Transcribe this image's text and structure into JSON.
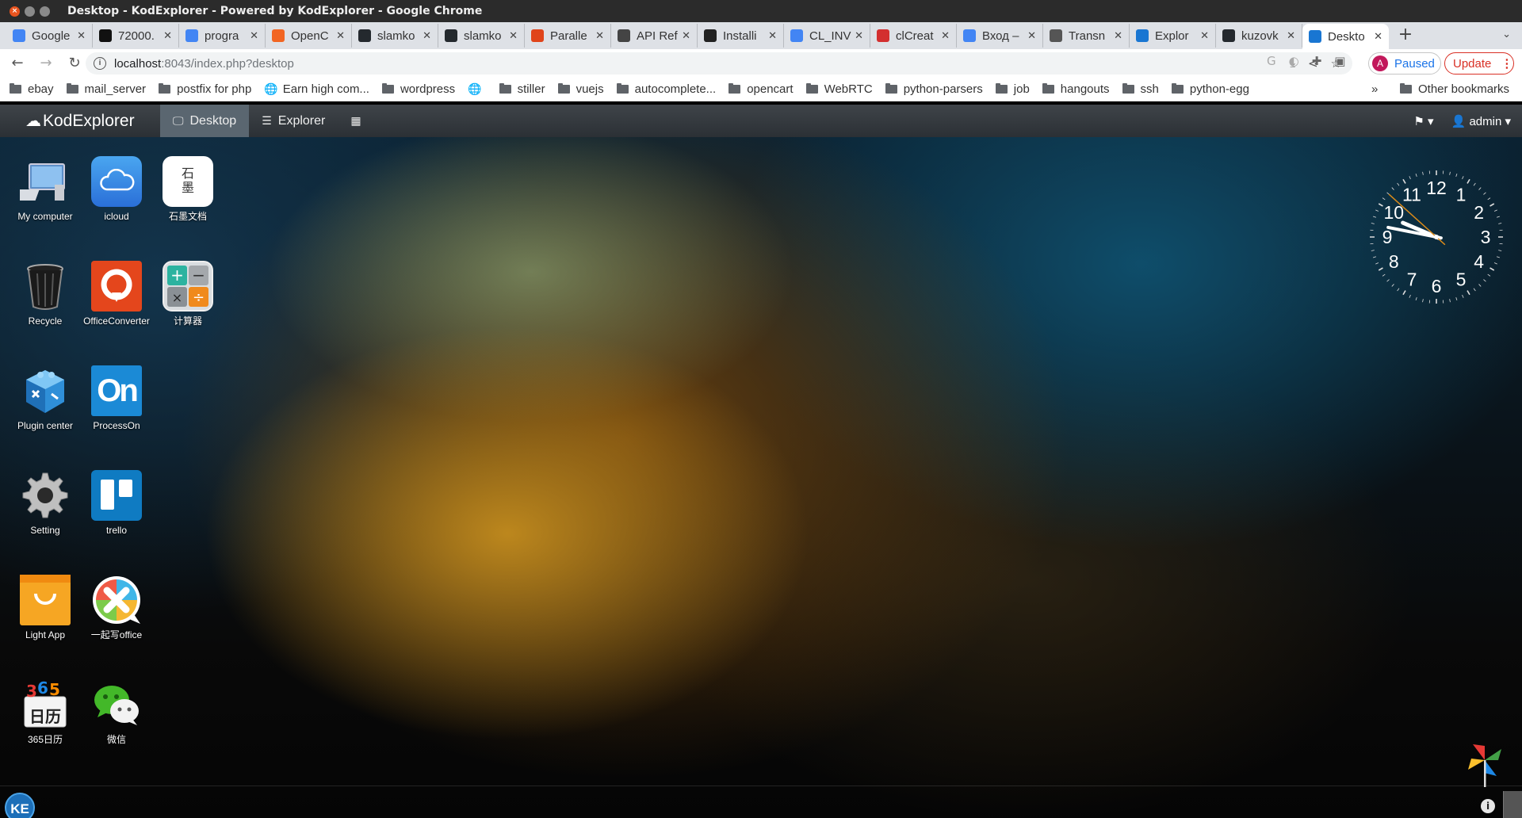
{
  "window": {
    "title": "Desktop - KodExplorer - Powered by KodExplorer - Google Chrome"
  },
  "tabs": [
    {
      "label": "Google",
      "icon": "google-docs-icon",
      "color": "#4285f4"
    },
    {
      "label": "72000.",
      "icon": "pycharm-icon",
      "color": "#111111"
    },
    {
      "label": "progra",
      "icon": "google-g-icon",
      "color": "#4285f4"
    },
    {
      "label": "OpenC",
      "icon": "opencart-icon",
      "color": "#f26522"
    },
    {
      "label": "slamko",
      "icon": "github-icon",
      "color": "#24292e"
    },
    {
      "label": "slamko",
      "icon": "github-icon",
      "color": "#24292e"
    },
    {
      "label": "Paralle",
      "icon": "shield-icon",
      "color": "#e0441a"
    },
    {
      "label": "API Ref",
      "icon": "book-icon",
      "color": "#444444"
    },
    {
      "label": "Installi",
      "icon": "installer-icon",
      "color": "#222222"
    },
    {
      "label": "CL_INV",
      "icon": "google-g-icon",
      "color": "#4285f4"
    },
    {
      "label": "clCreat",
      "icon": "opencl-icon",
      "color": "#d32f2f"
    },
    {
      "label": "Вход –",
      "icon": "google-g-icon",
      "color": "#4285f4"
    },
    {
      "label": "Transn",
      "icon": "translate-icon",
      "color": "#555555"
    },
    {
      "label": "Explor",
      "icon": "kodexplorer-icon",
      "color": "#1976d2"
    },
    {
      "label": "kuzovk",
      "icon": "github-icon",
      "color": "#24292e"
    },
    {
      "label": "Deskto",
      "icon": "kodexplorer-icon",
      "color": "#1976d2",
      "active": true
    }
  ],
  "address": {
    "host": "localhost",
    "rest": ":8043/index.php?desktop"
  },
  "profile": {
    "initial": "A",
    "label": "Paused"
  },
  "update": {
    "label": "Update"
  },
  "bookmarks": [
    {
      "label": "ebay",
      "icon": "folder"
    },
    {
      "label": "mail_server",
      "icon": "folder"
    },
    {
      "label": "postfix for php",
      "icon": "folder"
    },
    {
      "label": "Earn high com...",
      "icon": "globe"
    },
    {
      "label": "wordpress",
      "icon": "folder"
    },
    {
      "label": "",
      "icon": "globe"
    },
    {
      "label": "stiller",
      "icon": "folder"
    },
    {
      "label": "vuejs",
      "icon": "folder"
    },
    {
      "label": "autocomplete...",
      "icon": "folder"
    },
    {
      "label": "opencart",
      "icon": "folder"
    },
    {
      "label": "WebRTC",
      "icon": "folder"
    },
    {
      "label": "python-parsers",
      "icon": "folder"
    },
    {
      "label": "job",
      "icon": "folder"
    },
    {
      "label": "hangouts",
      "icon": "folder"
    },
    {
      "label": "ssh",
      "icon": "folder"
    },
    {
      "label": "python-egg",
      "icon": "folder"
    }
  ],
  "bookmarks_more": "»",
  "bookmarks_other": "Other bookmarks",
  "kod": {
    "brand": "KodExplorer",
    "nav": [
      {
        "label": "Desktop",
        "icon": "monitor-icon",
        "active": true
      },
      {
        "label": "Explorer",
        "icon": "list-icon"
      },
      {
        "label": "",
        "icon": "grid-icon"
      }
    ],
    "user": "admin"
  },
  "desktop_icons": [
    {
      "label": "My computer",
      "icon": "computer-icon"
    },
    {
      "label": "icloud",
      "icon": "icloud-icon"
    },
    {
      "label": "石墨文档",
      "icon": "shimo-icon"
    },
    {
      "label": "Recycle",
      "icon": "recycle-bin-icon"
    },
    {
      "label": "OfficeConverter",
      "icon": "office-converter-icon"
    },
    {
      "label": "计算器",
      "icon": "calculator-icon"
    },
    {
      "label": "Plugin center",
      "icon": "plugin-center-icon"
    },
    {
      "label": "ProcessOn",
      "icon": "processon-icon"
    },
    {
      "label": "Setting",
      "icon": "gear-icon"
    },
    {
      "label": "trello",
      "icon": "trello-icon"
    },
    {
      "label": "Light App",
      "icon": "light-app-icon"
    },
    {
      "label": "一起写office",
      "icon": "yiqixie-icon"
    },
    {
      "label": "365日历",
      "icon": "calendar-365-icon"
    },
    {
      "label": "微信",
      "icon": "wechat-icon"
    }
  ],
  "clock": {
    "hour": 9,
    "minute": 46,
    "second": 52,
    "numbers": [
      "12",
      "1",
      "2",
      "3",
      "4",
      "5",
      "6",
      "7",
      "8",
      "9",
      "10",
      "11"
    ]
  },
  "dock": {
    "start_label": "KE"
  }
}
